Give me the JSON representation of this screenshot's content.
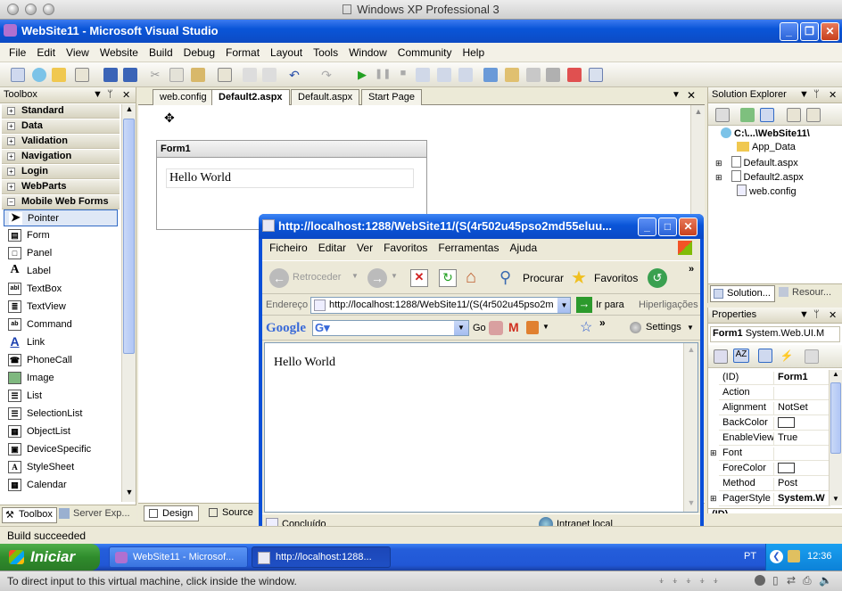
{
  "host": {
    "title": "Windows XP Professional 3",
    "status_text": "To direct input to this virtual machine, click inside the window."
  },
  "vs": {
    "title": "WebSite11 - Microsoft Visual Studio",
    "menu": [
      "File",
      "Edit",
      "View",
      "Website",
      "Build",
      "Debug",
      "Format",
      "Layout",
      "Tools",
      "Window",
      "Community",
      "Help"
    ],
    "status": "Build succeeded"
  },
  "toolbox": {
    "title": "Toolbox",
    "categories": [
      "Standard",
      "Data",
      "Validation",
      "Navigation",
      "Login",
      "WebParts",
      "Mobile Web Forms"
    ],
    "items": [
      "Pointer",
      "Form",
      "Panel",
      "Label",
      "TextBox",
      "TextView",
      "Command",
      "Link",
      "PhoneCall",
      "Image",
      "List",
      "SelectionList",
      "ObjectList",
      "DeviceSpecific",
      "StyleSheet",
      "Calendar"
    ],
    "bottom_tabs": [
      "Toolbox",
      "Server Exp..."
    ]
  },
  "editor": {
    "tabs": [
      "web.config",
      "Default2.aspx",
      "Default.aspx",
      "Start Page"
    ],
    "form_label": "Form1",
    "label_text": "Hello World",
    "view_tabs": [
      "Design",
      "Source"
    ]
  },
  "solution_explorer": {
    "title": "Solution Explorer",
    "items": [
      "C:\\...\\WebSite11\\",
      "App_Data",
      "Default.aspx",
      "Default2.aspx",
      "web.config"
    ],
    "bottom_tabs": [
      "Solution...",
      "Resour..."
    ]
  },
  "properties": {
    "title": "Properties",
    "object": "Form1",
    "object_type": "System.Web.UI.M",
    "rows": [
      {
        "name": "(ID)",
        "value": "Form1"
      },
      {
        "name": "Action",
        "value": ""
      },
      {
        "name": "Alignment",
        "value": "NotSet"
      },
      {
        "name": "BackColor",
        "value": ""
      },
      {
        "name": "EnableView",
        "value": "True"
      },
      {
        "name": "Font",
        "value": ""
      },
      {
        "name": "ForeColor",
        "value": ""
      },
      {
        "name": "Method",
        "value": "Post"
      },
      {
        "name": "PagerStyle",
        "value": "System.W"
      }
    ],
    "footer": "(ID)"
  },
  "ie": {
    "title": "http://localhost:1288/WebSite11/(S(4r502u45pso2md55eluu...",
    "menu": [
      "Ficheiro",
      "Editar",
      "Ver",
      "Favoritos",
      "Ferramentas",
      "Ajuda"
    ],
    "back_label": "Retroceder",
    "search_label": "Procurar",
    "favorites_label": "Favoritos",
    "address_label": "Endereço",
    "address_value": "http://localhost:1288/WebSite11/(S(4r502u45pso2m",
    "go_label": "Ir para",
    "links_label": "Hiperligações",
    "google_label": "Google",
    "google_go": "Go",
    "settings_label": "Settings",
    "content_text": "Hello World",
    "status_text": "Concluído",
    "zone_text": "Intranet local"
  },
  "taskbar": {
    "start": "Iniciar",
    "tasks": [
      "WebSite11 - Microsof...",
      "http://localhost:1288..."
    ],
    "lang": "PT",
    "time": "12:36"
  }
}
